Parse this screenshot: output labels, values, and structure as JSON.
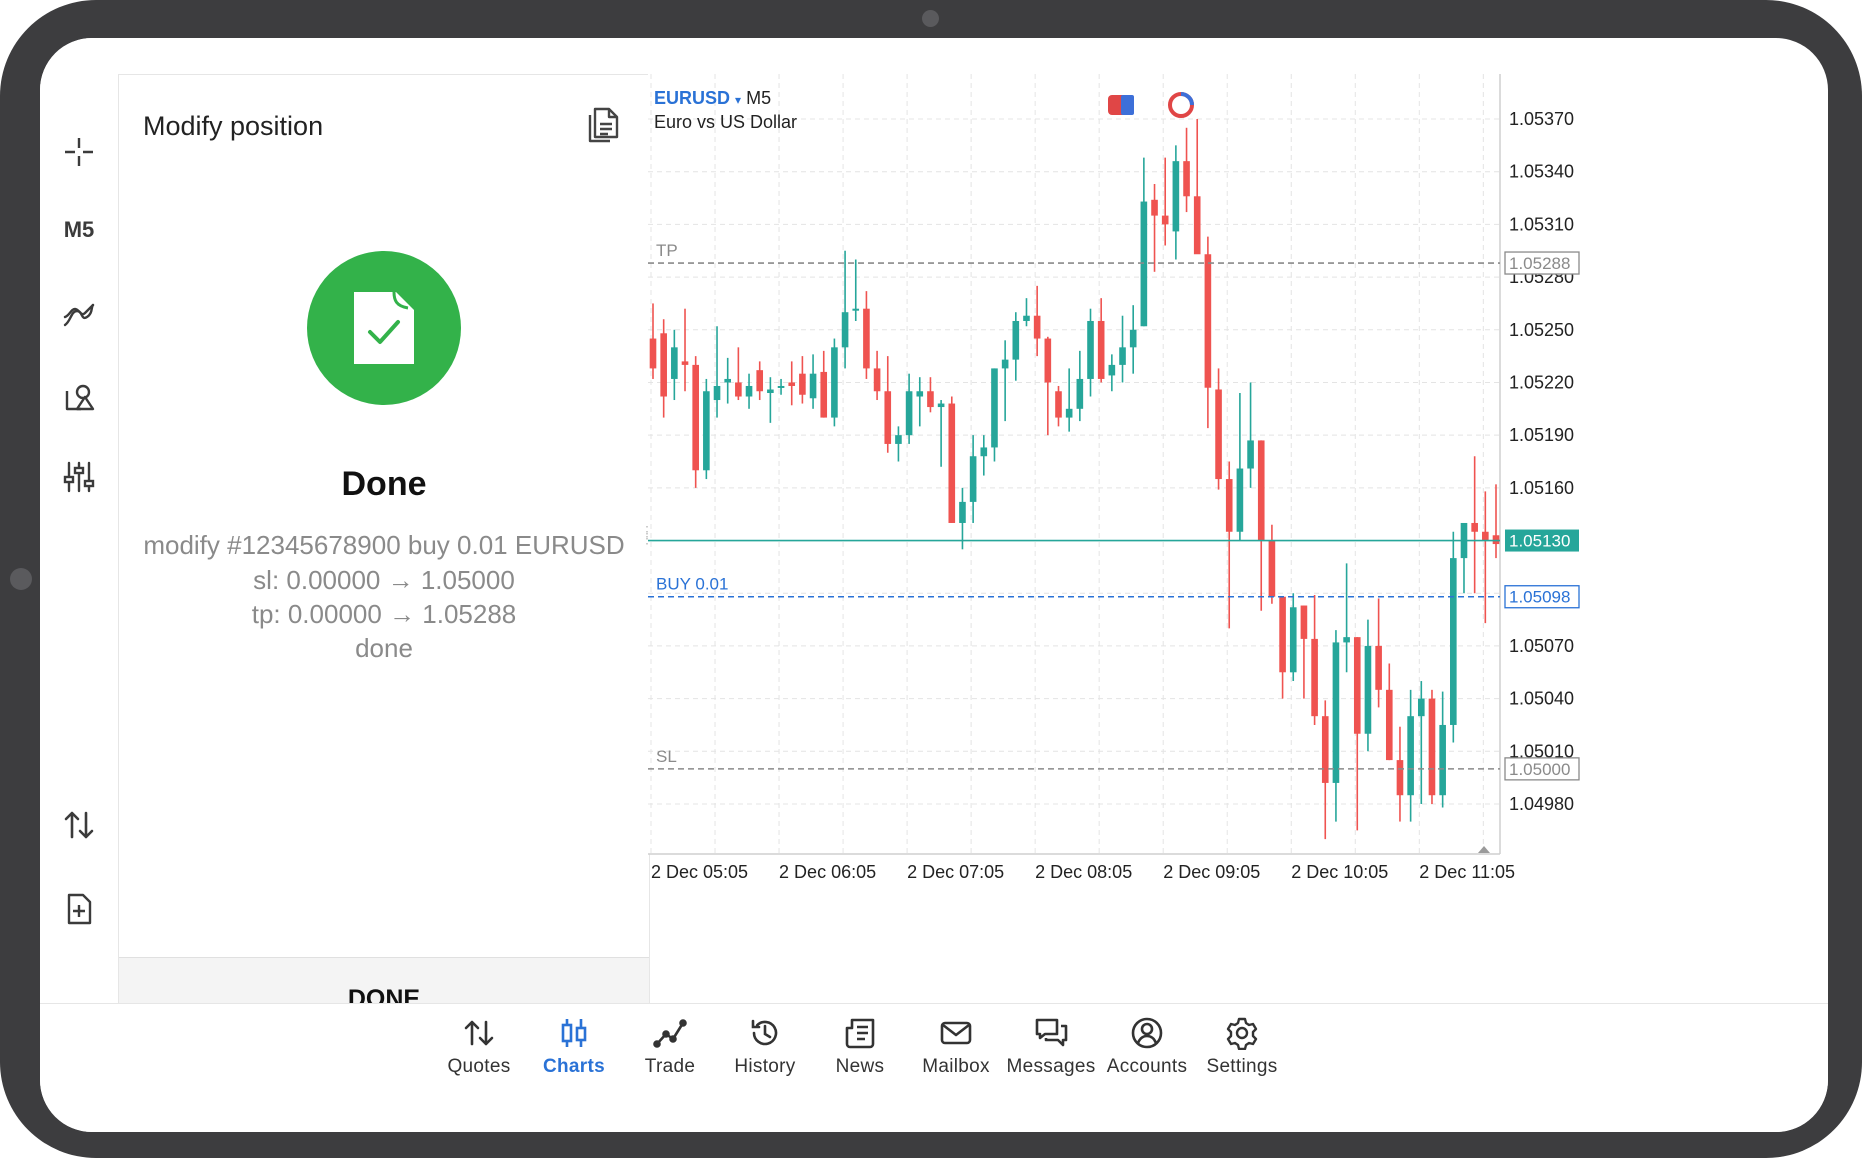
{
  "left_toolbar": {
    "timeframe_label": "M5",
    "icons": [
      "crosshair-icon",
      "indicators-icon",
      "objects-icon",
      "chart-settings-icon",
      "one-click-trading-icon",
      "new-order-icon"
    ]
  },
  "panel": {
    "title": "Modify position",
    "status_title": "Done",
    "line1_prefix": "modify #12345678900",
    "line1_suffix": "buy 0.01 EURUSD",
    "line2": "sl: 0.00000 → 1.05000",
    "line3": "tp: 0.00000 → 1.05288",
    "line4": "done",
    "done_button": "DONE"
  },
  "chart_header": {
    "symbol": "EURUSD",
    "dropdown": "▾",
    "timeframe": "M5",
    "description": "Euro vs US Dollar"
  },
  "colors": {
    "bull": "#26a69a",
    "bear": "#ef5350",
    "accent": "#2a72d6",
    "done_green": "#33b24a"
  },
  "chart_data": {
    "type": "candlestick",
    "symbol": "EURUSD",
    "timeframe": "M5",
    "ylim": [
      1.0495,
      1.0538
    ],
    "y_ticks": [
      "1.05370",
      "1.05340",
      "1.05310",
      "1.05280",
      "1.05250",
      "1.05220",
      "1.05190",
      "1.05160",
      "1.05130",
      "1.05100",
      "1.05070",
      "1.05040",
      "1.05010",
      "1.04980"
    ],
    "x_ticks": [
      "2 Dec 05:05",
      "2 Dec 06:05",
      "2 Dec 07:05",
      "2 Dec 08:05",
      "2 Dec 09:05",
      "2 Dec 10:05",
      "2 Dec 11:05"
    ],
    "current_price": 1.0513,
    "current_price_label": "1.05130",
    "levels": [
      {
        "name": "TP",
        "label": "TP",
        "price": 1.05288,
        "price_label": "1.05288"
      },
      {
        "name": "BUY",
        "label": "BUY 0.01",
        "price": 1.05098,
        "price_label": "1.05098"
      },
      {
        "name": "SL",
        "label": "SL",
        "price": 1.05,
        "price_label": "1.05000"
      }
    ],
    "candles": [
      [
        1.05245,
        1.05265,
        1.05222,
        1.05228
      ],
      [
        1.05248,
        1.05256,
        1.052,
        1.05212
      ],
      [
        1.05222,
        1.0525,
        1.0521,
        1.0524
      ],
      [
        1.05232,
        1.05262,
        1.05215,
        1.0523
      ],
      [
        1.0523,
        1.05235,
        1.0516,
        1.0517
      ],
      [
        1.0517,
        1.05222,
        1.05165,
        1.05215
      ],
      [
        1.0521,
        1.05252,
        1.052,
        1.05218
      ],
      [
        1.0522,
        1.05234,
        1.05208,
        1.05222
      ],
      [
        1.0522,
        1.0524,
        1.0521,
        1.05212
      ],
      [
        1.05212,
        1.05225,
        1.05205,
        1.05218
      ],
      [
        1.05227,
        1.05232,
        1.0521,
        1.05215
      ],
      [
        1.05214,
        1.05223,
        1.05197,
        1.05216
      ],
      [
        1.05218,
        1.05222,
        1.05213,
        1.05218
      ],
      [
        1.0522,
        1.05232,
        1.05207,
        1.05218
      ],
      [
        1.05225,
        1.05235,
        1.05208,
        1.05213
      ],
      [
        1.05211,
        1.05236,
        1.05205,
        1.05225
      ],
      [
        1.05226,
        1.05238,
        1.052,
        1.052
      ],
      [
        1.052,
        1.05245,
        1.05195,
        1.0524
      ],
      [
        1.0524,
        1.05295,
        1.05228,
        1.0526
      ],
      [
        1.05262,
        1.0529,
        1.05255,
        1.05262
      ],
      [
        1.05262,
        1.05272,
        1.05222,
        1.05228
      ],
      [
        1.05228,
        1.05238,
        1.0521,
        1.05215
      ],
      [
        1.05215,
        1.05235,
        1.0518,
        1.05185
      ],
      [
        1.05185,
        1.05195,
        1.05175,
        1.0519
      ],
      [
        1.0519,
        1.05225,
        1.05185,
        1.05215
      ],
      [
        1.05212,
        1.05223,
        1.05195,
        1.05215
      ],
      [
        1.05215,
        1.05223,
        1.05203,
        1.05206
      ],
      [
        1.05206,
        1.0521,
        1.05172,
        1.05208
      ],
      [
        1.05208,
        1.05212,
        1.0514,
        1.0514
      ],
      [
        1.0514,
        1.0516,
        1.05125,
        1.05152
      ],
      [
        1.05152,
        1.0519,
        1.0514,
        1.05178
      ],
      [
        1.05178,
        1.0519,
        1.05167,
        1.05183
      ],
      [
        1.05183,
        1.05228,
        1.05175,
        1.05228
      ],
      [
        1.05228,
        1.05244,
        1.05198,
        1.05233
      ],
      [
        1.05233,
        1.0526,
        1.05221,
        1.05255
      ],
      [
        1.05255,
        1.05268,
        1.05252,
        1.05258
      ],
      [
        1.05258,
        1.05275,
        1.05235,
        1.05245
      ],
      [
        1.05245,
        1.05246,
        1.0519,
        1.0522
      ],
      [
        1.05215,
        1.05218,
        1.05195,
        1.052
      ],
      [
        1.052,
        1.05228,
        1.05192,
        1.05205
      ],
      [
        1.05205,
        1.05238,
        1.05198,
        1.05222
      ],
      [
        1.05222,
        1.05262,
        1.05212,
        1.05255
      ],
      [
        1.05255,
        1.05268,
        1.0522,
        1.05222
      ],
      [
        1.05224,
        1.05236,
        1.05215,
        1.0523
      ],
      [
        1.0523,
        1.05258,
        1.0522,
        1.0524
      ],
      [
        1.0524,
        1.05264,
        1.05225,
        1.0525
      ],
      [
        1.05252,
        1.05348,
        1.05252,
        1.05323
      ],
      [
        1.05324,
        1.05333,
        1.05283,
        1.05315
      ],
      [
        1.05315,
        1.05348,
        1.05298,
        1.0531
      ],
      [
        1.05306,
        1.05355,
        1.0529,
        1.05346
      ],
      [
        1.05346,
        1.05365,
        1.05317,
        1.05326
      ],
      [
        1.05326,
        1.0537,
        1.05294,
        1.05293
      ],
      [
        1.05293,
        1.05303,
        1.05194,
        1.05217
      ],
      [
        1.05216,
        1.05228,
        1.05159,
        1.05165
      ],
      [
        1.05165,
        1.05175,
        1.0508,
        1.05135
      ],
      [
        1.05135,
        1.05214,
        1.0513,
        1.05171
      ],
      [
        1.05171,
        1.0522,
        1.0516,
        1.05187
      ],
      [
        1.05187,
        1.05187,
        1.0509,
        1.0513
      ],
      [
        1.0513,
        1.05139,
        1.05094,
        1.05098
      ],
      [
        1.05098,
        1.05098,
        1.0504,
        1.05055
      ],
      [
        1.05055,
        1.051,
        1.0505,
        1.05092
      ],
      [
        1.05093,
        1.05093,
        1.0504,
        1.05074
      ],
      [
        1.05074,
        1.05099,
        1.05025,
        1.0503
      ],
      [
        1.0503,
        1.05039,
        1.0496,
        1.04992
      ],
      [
        1.04992,
        1.05079,
        1.0497,
        1.05072
      ],
      [
        1.05072,
        1.05117,
        1.05055,
        1.05075
      ],
      [
        1.05075,
        1.05075,
        1.04965,
        1.0502
      ],
      [
        1.0502,
        1.05085,
        1.0501,
        1.0507
      ],
      [
        1.0507,
        1.05097,
        1.05035,
        1.05045
      ],
      [
        1.05045,
        1.0506,
        1.05005,
        1.05005
      ],
      [
        1.05005,
        1.05024,
        1.0497,
        1.04985
      ],
      [
        1.04985,
        1.05045,
        1.0497,
        1.0503
      ],
      [
        1.0503,
        1.0505,
        1.0498,
        1.0504
      ],
      [
        1.0504,
        1.05045,
        1.0498,
        1.04985
      ],
      [
        1.04985,
        1.05044,
        1.04978,
        1.05025
      ],
      [
        1.05025,
        1.05135,
        1.05015,
        1.0512
      ],
      [
        1.0512,
        1.05135,
        1.051,
        1.0514
      ],
      [
        1.0514,
        1.05178,
        1.051,
        1.05135
      ],
      [
        1.05135,
        1.05158,
        1.05083,
        1.0513
      ],
      [
        1.05133,
        1.05162,
        1.0512,
        1.05128
      ]
    ]
  },
  "bottom_nav": {
    "items": [
      {
        "label": "Quotes",
        "icon": "quotes-icon"
      },
      {
        "label": "Charts",
        "icon": "charts-icon",
        "active": true
      },
      {
        "label": "Trade",
        "icon": "trade-icon"
      },
      {
        "label": "History",
        "icon": "history-icon"
      },
      {
        "label": "News",
        "icon": "news-icon"
      },
      {
        "label": "Mailbox",
        "icon": "mailbox-icon"
      },
      {
        "label": "Messages",
        "icon": "messages-icon"
      },
      {
        "label": "Accounts",
        "icon": "accounts-icon"
      },
      {
        "label": "Settings",
        "icon": "settings-icon"
      }
    ]
  }
}
